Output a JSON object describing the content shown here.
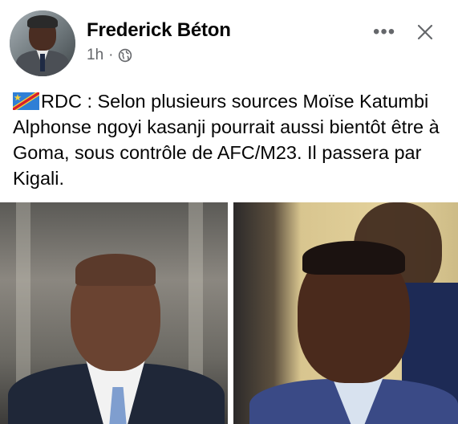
{
  "post": {
    "author": "Frederick Béton",
    "time": "1h",
    "separator": "·",
    "audience_icon": "globe-icon",
    "more_icon": "more-options-icon",
    "more_label": "•••",
    "close_icon": "close-icon",
    "flag_icon": "drc-flag-icon",
    "text": "RDC : Selon plusieurs sources Moïse Katumbi Alphonse ngoyi kasanji pourrait aussi bientôt être à Goma, sous contrôle de AFC/M23. Il passera par Kigali.",
    "photos": [
      "photo-left",
      "photo-right"
    ]
  },
  "colors": {
    "name": "#050505",
    "meta": "#65676b",
    "background": "#ffffff"
  }
}
